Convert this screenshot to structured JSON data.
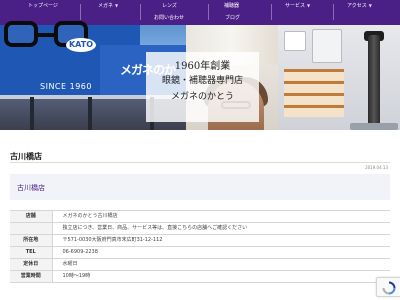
{
  "nav": {
    "items": [
      {
        "label": "トップページ",
        "dropdown": false
      },
      {
        "label": "メガネ",
        "dropdown": true
      },
      {
        "label": "レンズ",
        "dropdown": false
      },
      {
        "label": "補聴器",
        "dropdown": false
      },
      {
        "label": "サービス",
        "dropdown": true
      },
      {
        "label": "アクセス",
        "dropdown": true
      },
      {
        "label": "お問い合わせ",
        "dropdown": false
      },
      {
        "label": "ブログ",
        "dropdown": false
      }
    ],
    "background": "#4a1f86"
  },
  "hero": {
    "sign_brand": "KATO",
    "sign_since": "SINCE 1960",
    "sign_kanji": "メガネのか",
    "line1": "1960年創業",
    "line2": "眼鏡・補聴器専門店",
    "line3": "メガネのかとう"
  },
  "page": {
    "title": "古川橋店",
    "date": "2019.04.13"
  },
  "store": {
    "card_title": "古川橋店",
    "accent_color": "#4a1f86",
    "rows": [
      {
        "key": "店舗",
        "value": "メガネのかとう古川橋店"
      },
      {
        "key": "",
        "value": "独立店につき、営業日、商品、サービス等は、直接こちらの店舗へご確認ください"
      },
      {
        "key": "所在地",
        "value": "〒571-0030大阪府門真市末広町31-12-112"
      },
      {
        "key": "TEL",
        "value": "06-6909-2238"
      },
      {
        "key": "定休日",
        "value": "水曜日"
      },
      {
        "key": "営業時間",
        "value": "10時～19時"
      }
    ]
  }
}
